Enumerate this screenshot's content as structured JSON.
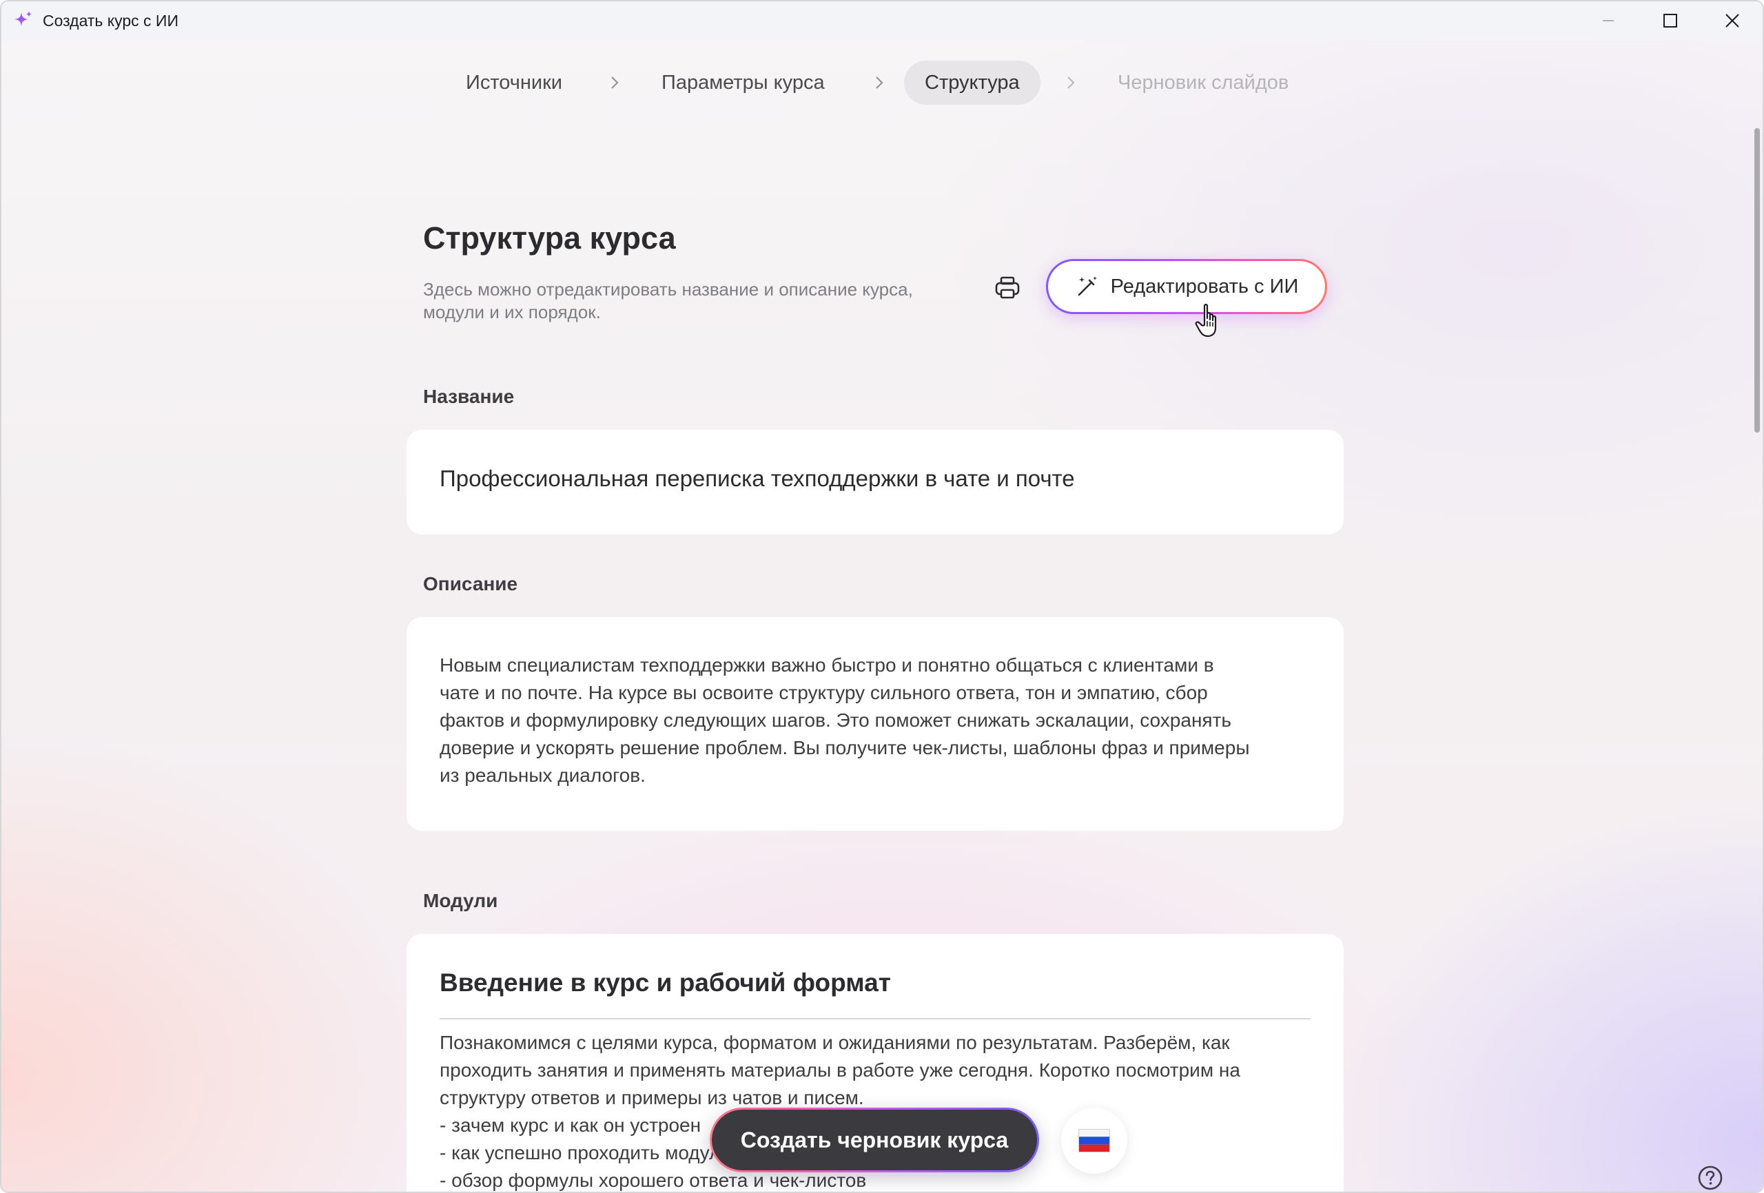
{
  "window": {
    "title": "Создать курс с ИИ",
    "icon": "sparkle-icon",
    "accent_color": "#b65cff"
  },
  "stepper": {
    "steps": [
      {
        "label": "Источники",
        "state": "done"
      },
      {
        "label": "Параметры курса",
        "state": "done"
      },
      {
        "label": "Структура",
        "state": "active"
      },
      {
        "label": "Черновик слайдов",
        "state": "disabled"
      }
    ]
  },
  "header": {
    "title": "Структура курса",
    "subtitle": "Здесь можно отредактировать название и описание курса,\nмодули и их порядок.",
    "print_icon": "printer-icon",
    "ai_edit_label": "Редактировать с ИИ",
    "ai_edit_icon": "magic-wand-icon"
  },
  "fields": {
    "name_label": "Название",
    "name_value": "Профессиональная переписка техподдержки в чате и почте",
    "description_label": "Описание",
    "description_value": "Новым специалистам техподдержки важно быстро и понятно общаться с клиентами в\nчате и по почте. На курсе вы освоите структуру сильного ответа, тон и эмпатию, сбор\nфактов и формулировку следующих шагов. Это поможет снижать эскалации, сохранять\nдоверие и ускорять решение проблем. Вы получите чек-листы, шаблоны фраз и примеры\nиз реальных диалогов."
  },
  "modules": {
    "label": "Модули",
    "items": [
      {
        "title": "Введение в курс и рабочий формат",
        "description": "Познакомимся с целями курса, форматом и ожиданиями по результатам. Разберём, как\nпроходить занятия и применять материалы в работе уже сегодня. Коротко посмотрим на\nструктуру ответов и примеры из чатов и писем.",
        "bullets": [
          "- зачем курс и как он устроен",
          "- как успешно проходить модули",
          "- обзор формулы хорошего ответа и чек-листов"
        ]
      }
    ]
  },
  "footer": {
    "create_label": "Создать черновик курса",
    "language_icon": "russia-flag-icon",
    "help_icon": "help-icon"
  }
}
